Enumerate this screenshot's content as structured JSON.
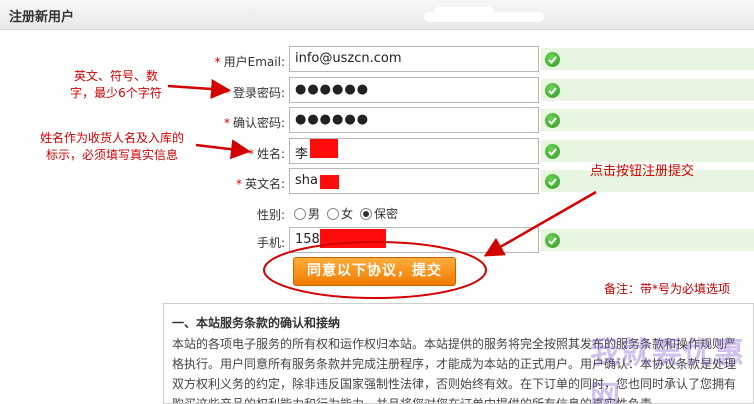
{
  "header": {
    "title": "注册新用户"
  },
  "form": {
    "email": {
      "label": "用户Email:",
      "value": "info@uszcn.com"
    },
    "password": {
      "label": "登录密码:",
      "value": "●●●●●●"
    },
    "confirm": {
      "label": "确认密码:",
      "value": "●●●●●●"
    },
    "name": {
      "label": "姓名:",
      "value": "李"
    },
    "english_name": {
      "label": "英文名:",
      "value": "sha"
    },
    "gender": {
      "label": "性别:",
      "options": [
        "男",
        "女",
        "保密"
      ],
      "selected": "保密"
    },
    "phone": {
      "label": "手机:",
      "value": "158"
    },
    "required_mark": "*"
  },
  "submit": {
    "label": "同意以下协议，提交"
  },
  "note": "备注：带*号为必填选项",
  "annotations": {
    "password_hint": [
      "英文、符号、数",
      "字，最少6个字符"
    ],
    "name_hint": [
      "姓名作为收货人名及入库的",
      "标示，必须填写真实信息"
    ],
    "submit_hint": "点击按钮注册提交"
  },
  "terms": {
    "heading": "一、本站服务条款的确认和接纳",
    "body": "本站的各项电子服务的所有权和运作权归本站。本站提供的服务将完全按照其发布的服务条款和操作规则严格执行。用户同意所有服务条款并完成注册程序，才能成为本站的正式用户。用户确认：本协议条款是处理双方权利义务的约定，除非违反国家强制性法律，否则始终有效。在下订单的同时，您也同时承认了您拥有购买这些产品的权利能力和行为能力，并且将您对您在订单中提供的所有信息的真实性负责。"
  },
  "watermark": "我就要优惠网",
  "colors": {
    "required": "#d40000",
    "button": "#f07a00",
    "hint_bg": "#e8f5e1",
    "check": "#2b9a1d"
  }
}
